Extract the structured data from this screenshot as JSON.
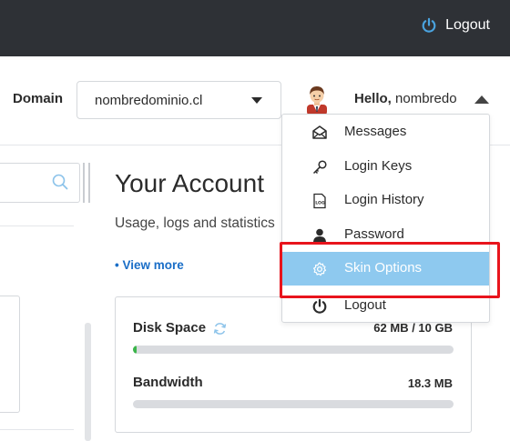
{
  "topbar": {
    "logout_label": "Logout",
    "logout_icon": "power-icon",
    "background": "#2e3136",
    "icon_color": "#4aa3df"
  },
  "header": {
    "domain_label": "Domain",
    "domain_value": "nombredominio.cl",
    "greeting_bold": "Hello,",
    "greeting_name": "nombredo"
  },
  "main": {
    "title": "Your Account",
    "subtitle": "Usage, logs and statistics",
    "view_more": "• View more",
    "stats": [
      {
        "label": "Disk Space",
        "value": "62 MB / 10 GB",
        "progress": 0.006
      },
      {
        "label": "Bandwidth",
        "value": "18.3 MB",
        "progress": 0.0
      }
    ]
  },
  "dropdown": {
    "items": [
      {
        "label": "Messages",
        "icon": "envelope-icon"
      },
      {
        "label": "Login Keys",
        "icon": "key-icon"
      },
      {
        "label": "Login History",
        "icon": "log-icon"
      },
      {
        "label": "Password",
        "icon": "user-icon"
      },
      {
        "label": "Skin Options",
        "icon": "gear-icon",
        "active": true
      },
      {
        "label": "Logout",
        "icon": "power-icon"
      }
    ],
    "active_color": "#8ec9ef",
    "highlight_color": "#e8141c"
  }
}
